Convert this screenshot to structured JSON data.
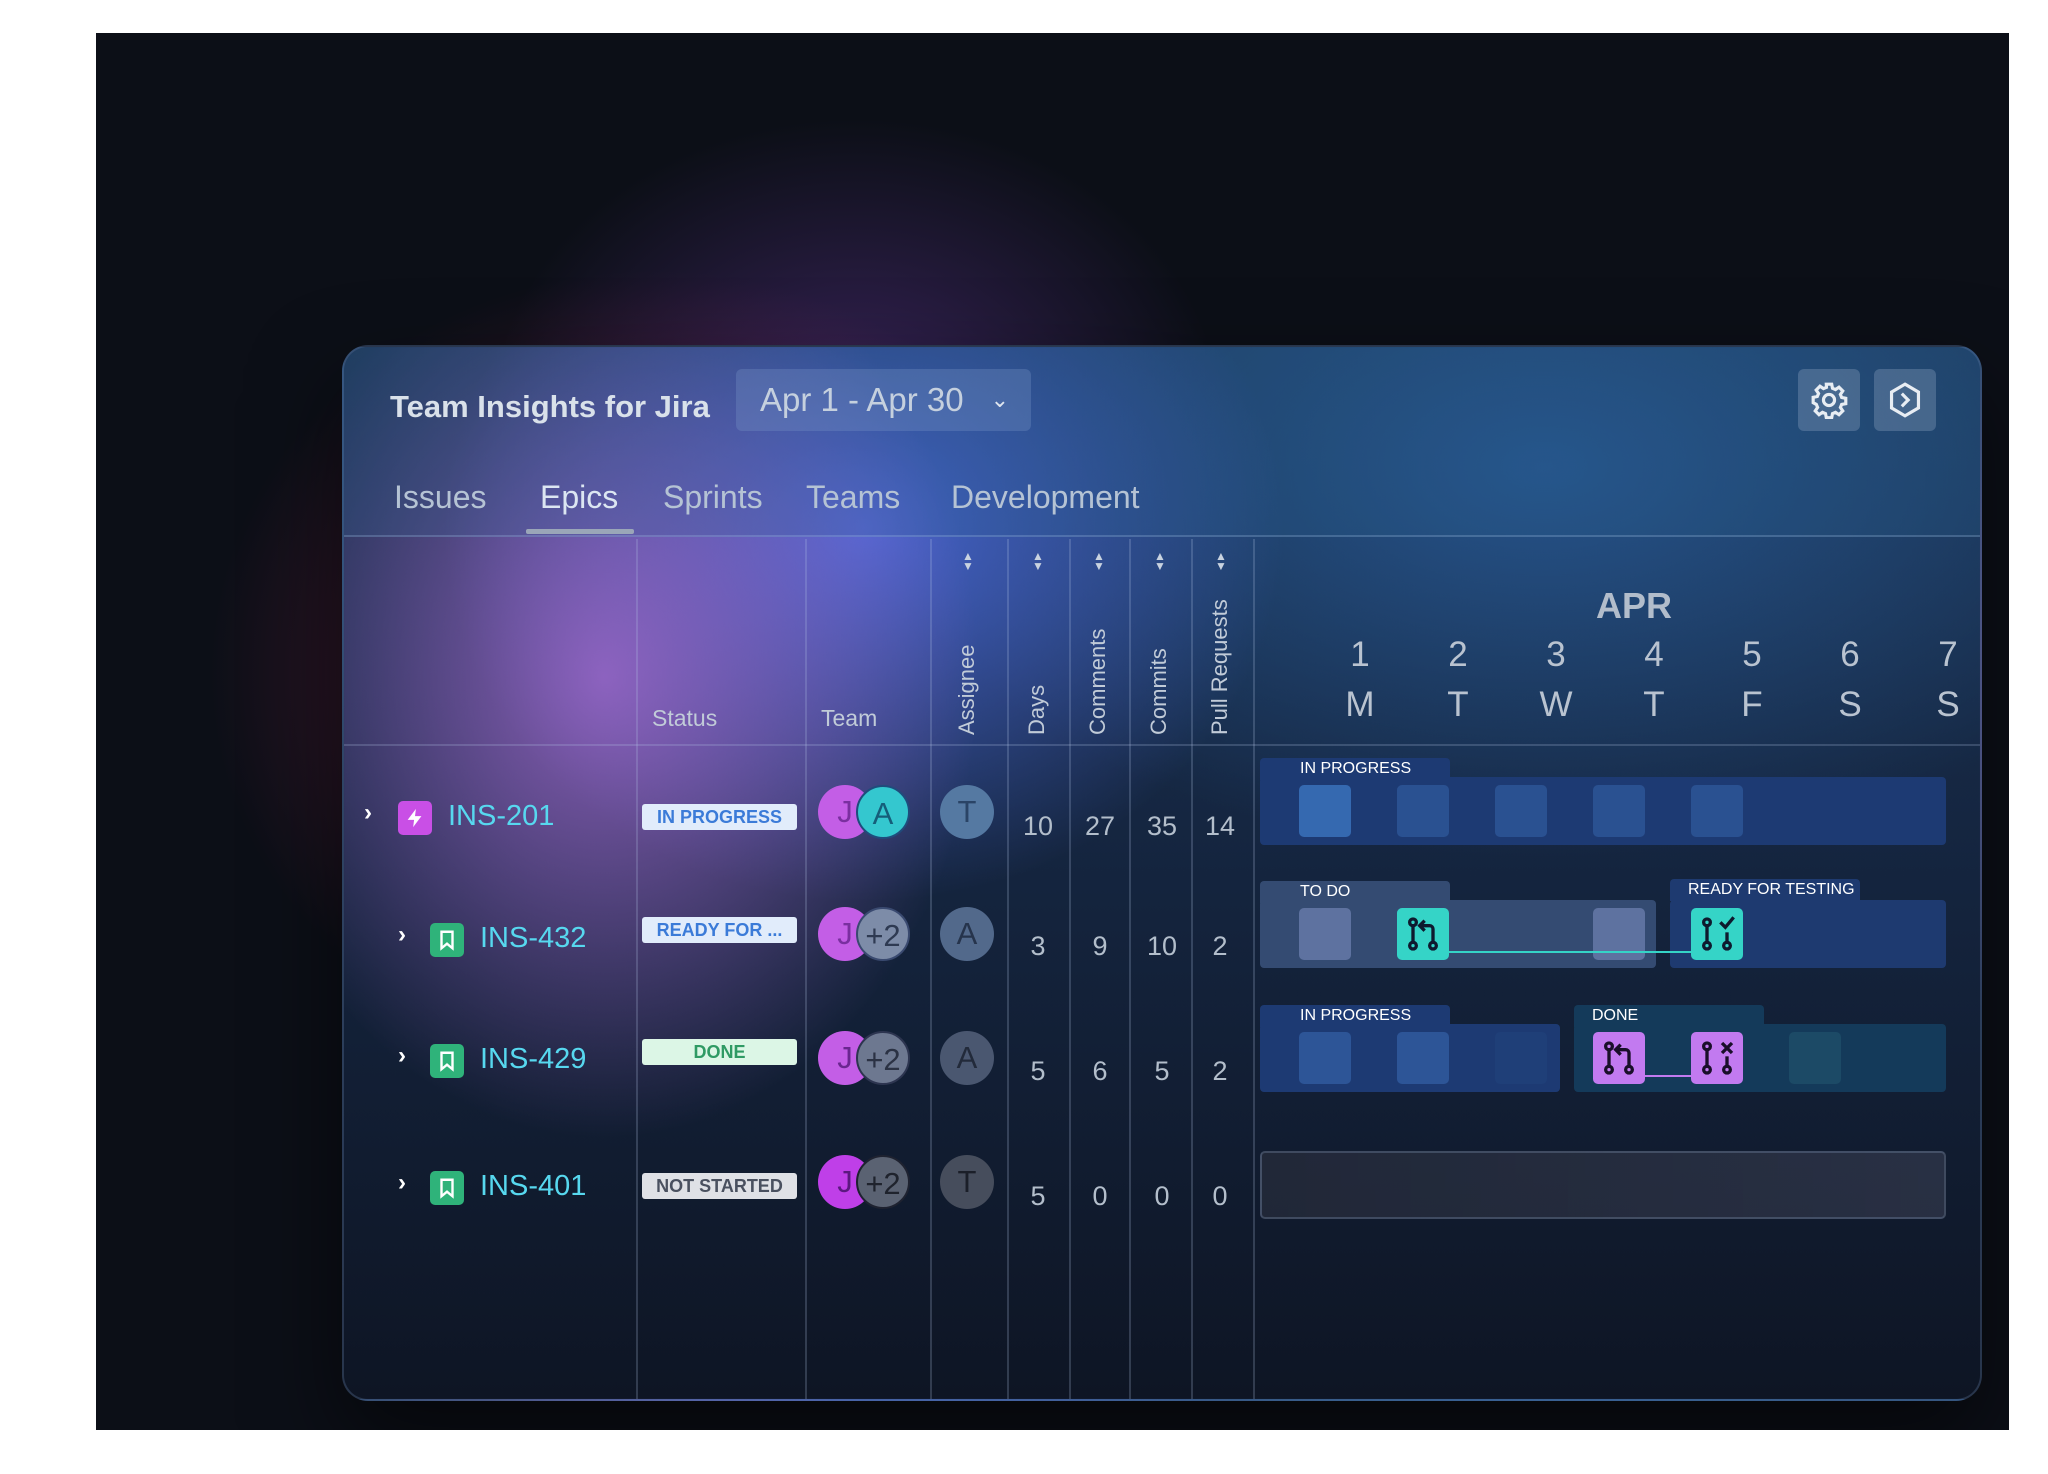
{
  "app": {
    "title": "Team Insights for Jira",
    "date_range": "Apr 1 - Apr 30"
  },
  "header_icons": [
    "gear-icon",
    "hexagon-logo-icon"
  ],
  "tabs": [
    {
      "label": "Issues",
      "active": false
    },
    {
      "label": "Epics",
      "active": true
    },
    {
      "label": "Sprints",
      "active": false
    },
    {
      "label": "Teams",
      "active": false
    },
    {
      "label": "Development",
      "active": false
    }
  ],
  "columns": {
    "status": "Status",
    "team": "Team",
    "assignee": "Assignee",
    "days": "Days",
    "comments": "Comments",
    "commits": "Commits",
    "pull_requests": "Pull Requests"
  },
  "calendar": {
    "month": "APR",
    "days": [
      {
        "num": "1",
        "letter": "M"
      },
      {
        "num": "2",
        "letter": "T"
      },
      {
        "num": "3",
        "letter": "W"
      },
      {
        "num": "4",
        "letter": "T"
      },
      {
        "num": "5",
        "letter": "F"
      },
      {
        "num": "6",
        "letter": "S"
      },
      {
        "num": "7",
        "letter": "S"
      }
    ]
  },
  "rows": [
    {
      "key": "INS-201",
      "type_icon": "lightning-icon",
      "status": "IN PROGRESS",
      "team": [
        "J",
        "A"
      ],
      "assignee": "T",
      "days": "10",
      "comments": "27",
      "commits": "35",
      "pull_requests": "14"
    },
    {
      "key": "INS-432",
      "type_icon": "bookmark-icon",
      "status": "READY FOR ...",
      "team": [
        "J",
        "+2"
      ],
      "assignee": "A",
      "days": "3",
      "comments": "9",
      "commits": "10",
      "pull_requests": "2"
    },
    {
      "key": "INS-429",
      "type_icon": "bookmark-icon",
      "status": "DONE",
      "team": [
        "J",
        "+2"
      ],
      "assignee": "A",
      "days": "5",
      "comments": "6",
      "commits": "5",
      "pull_requests": "2"
    },
    {
      "key": "INS-401",
      "type_icon": "bookmark-icon",
      "status": "NOT STARTED",
      "team": [
        "J",
        "+2"
      ],
      "assignee": "T",
      "days": "5",
      "comments": "0",
      "commits": "0",
      "pull_requests": "0"
    }
  ],
  "timeline": {
    "row1": {
      "segment": "IN PROGRESS"
    },
    "row2": {
      "segment_a": "TO DO",
      "segment_b": "READY FOR TESTING"
    },
    "row3": {
      "segment_a": "IN PROGRESS",
      "segment_b": "DONE"
    }
  },
  "colors": {
    "issue_key": "#57d8ef",
    "epic_icon": "#c94fe6",
    "story_icon": "#2fb37a",
    "pr_teal": "#35d4c7",
    "pr_purple": "#c27af0"
  }
}
